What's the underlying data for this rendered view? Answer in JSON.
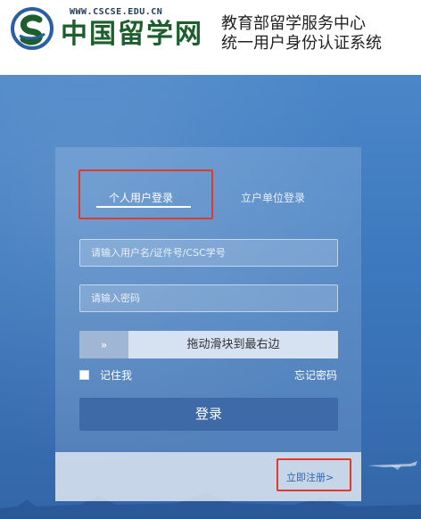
{
  "header": {
    "site_url": "WWW.CSCSE.EDU.CN",
    "site_name": "中国留学网",
    "org_title": "教育部留学服务中心",
    "org_subtitle": "统一用户身份认证系统"
  },
  "login": {
    "tabs": [
      {
        "label": "个人用户登录",
        "active": true
      },
      {
        "label": "立户单位登录",
        "active": false
      }
    ],
    "username_placeholder": "请输入用户名/证件号/CSC学号",
    "password_placeholder": "请输入密码",
    "slider_handle": "»",
    "slider_text": "拖动滑块到最右边",
    "remember_label": "记住我",
    "forgot_label": "忘记密码",
    "submit_label": "登录",
    "register_label": "立即注册>"
  },
  "colors": {
    "banner": "#3f7bc0",
    "highlight": "#e03a2e",
    "button": "#3e6aa8",
    "logo_green": "#1d5f2c",
    "logo_blue": "#2a5fa3"
  },
  "icons": {
    "logo": "cscse-logo-icon",
    "slider_handle": "double-chevron-right-icon",
    "checkbox": "checkbox-icon"
  }
}
